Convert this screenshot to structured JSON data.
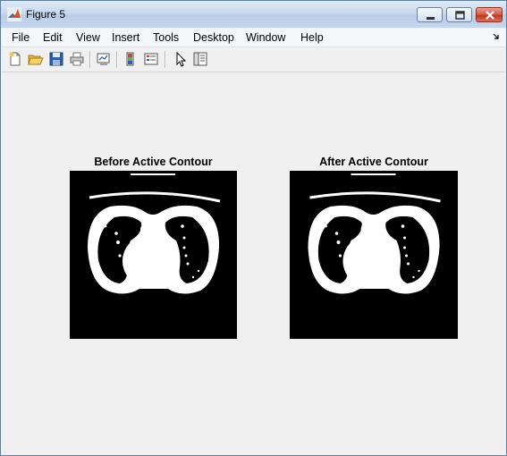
{
  "window": {
    "title": "Figure 5"
  },
  "menubar": {
    "items": [
      "File",
      "Edit",
      "View",
      "Insert",
      "Tools",
      "Desktop",
      "Window",
      "Help"
    ]
  },
  "toolbar": {
    "buttons": [
      {
        "name": "new-figure-icon"
      },
      {
        "name": "open-file-icon"
      },
      {
        "name": "save-icon"
      },
      {
        "name": "print-icon"
      },
      {
        "name": "link-plot-icon"
      },
      {
        "name": "insert-colorbar-icon"
      },
      {
        "name": "insert-legend-icon"
      },
      {
        "name": "edit-plot-arrow-icon"
      },
      {
        "name": "property-inspector-icon"
      }
    ]
  },
  "axes": [
    {
      "title": "Before Active Contour"
    },
    {
      "title": "After Active Contour"
    }
  ],
  "colors": {
    "figure_background": "#f0f0f0",
    "image_background": "#000000",
    "image_foreground": "#ffffff"
  }
}
